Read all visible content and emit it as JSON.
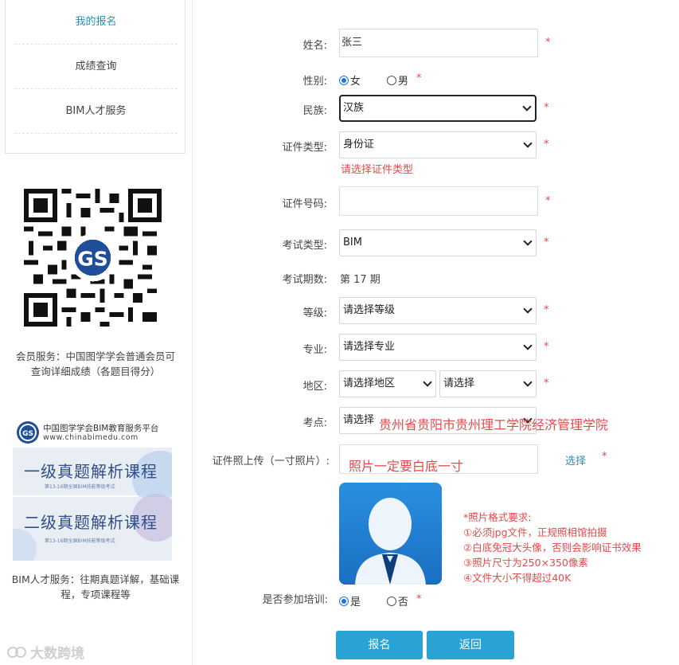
{
  "sidebar": {
    "nav": [
      {
        "label": "我的报名",
        "active": true
      },
      {
        "label": "成绩查询",
        "active": false
      },
      {
        "label": "BIM人才服务",
        "active": false
      }
    ],
    "member_text": "会员服务：中国图学学会普通会员可查询详细成绩（各题目得分）",
    "ad": {
      "title": "中国图学学会BIM教育服务平台",
      "url": "www.chinabimedu.com",
      "course1": "一级真题解析课程",
      "course2": "二级真题解析课程",
      "course_sub": "第13-16期全国BIM技能等级考试"
    },
    "talent_text": "BIM人才服务：往期真题详解，基础课程，专项课程等"
  },
  "form": {
    "name": {
      "label": "姓名:",
      "value": "张三"
    },
    "gender": {
      "label": "性别:",
      "options": [
        "女",
        "男"
      ],
      "selected": "女"
    },
    "ethnicity": {
      "label": "民族:",
      "value": "汉族"
    },
    "id_type": {
      "label": "证件类型:",
      "value": "身份证",
      "hint": "请选择证件类型"
    },
    "id_number": {
      "label": "证件号码:",
      "value": ""
    },
    "exam_type": {
      "label": "考试类型:",
      "value": "BIM"
    },
    "exam_period": {
      "label": "考试期数:",
      "value": "第 17 期"
    },
    "level": {
      "label": "等级:",
      "value": "请选择等级"
    },
    "major": {
      "label": "专业:",
      "value": "请选择专业"
    },
    "region": {
      "label": "地区:",
      "value1": "请选择地区",
      "value2": "请选择"
    },
    "exam_site": {
      "label": "考点:",
      "value": "请选择",
      "annotation": "贵州省贵阳市贵州理工学院经济管理学院"
    },
    "photo": {
      "label": "证件照上传（一寸照片）:",
      "annotation": "照片一定要白底一寸",
      "select_label": "选择"
    },
    "photo_requirements": [
      "*照片格式要求:",
      "①必须jpg文件，正规照相馆拍摄",
      "②白底免冠大头像，否则会影响证书效果",
      "③照片尺寸为250×350像素",
      "④文件大小不得超过40K"
    ],
    "training": {
      "label": "是否参加培训:",
      "options": [
        "是",
        "否"
      ],
      "selected": "是"
    },
    "required_mark": "*"
  },
  "buttons": {
    "submit": "报名",
    "back": "返回"
  },
  "watermark": "大数跨境",
  "colors": {
    "accent": "#2aa2d4",
    "link": "#2b8fb5",
    "error": "#e44a4a"
  }
}
